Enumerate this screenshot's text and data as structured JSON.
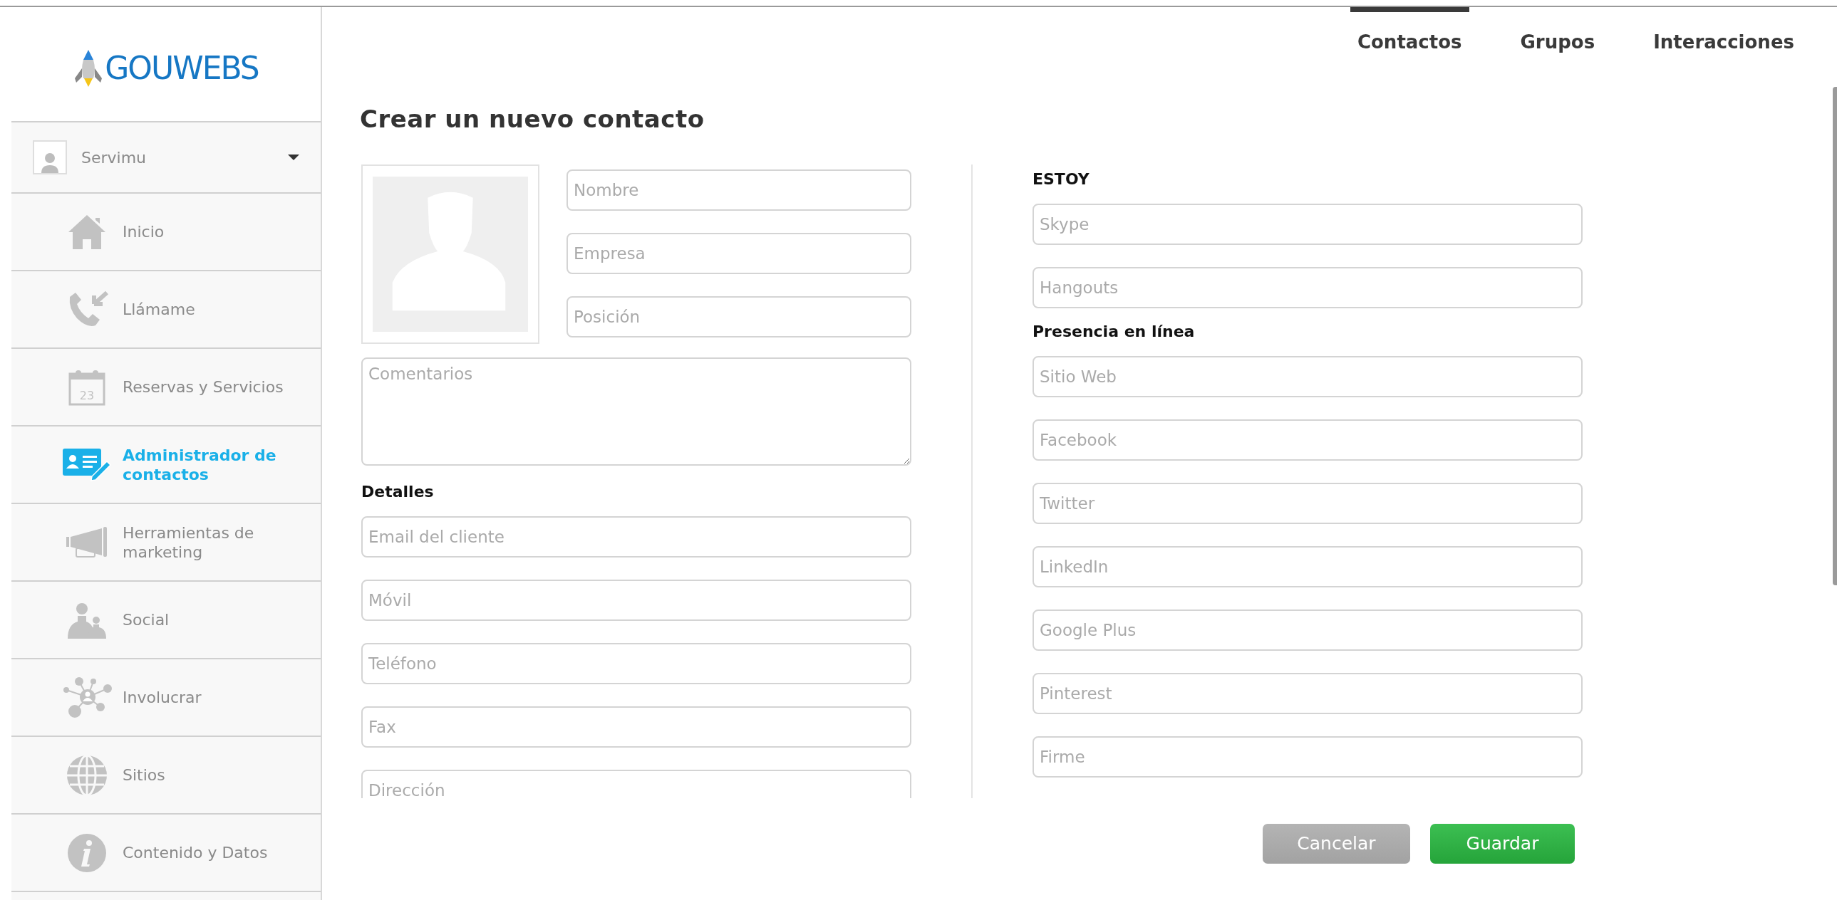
{
  "logo": {
    "text": "GOUWEBS"
  },
  "user": {
    "name": "Servimu"
  },
  "sidebar": {
    "items": [
      {
        "label": "Inicio",
        "selected": false
      },
      {
        "label": "Llámame",
        "selected": false
      },
      {
        "label": "Reservas y Servicios",
        "selected": false,
        "calendar_day": "23"
      },
      {
        "label": "Administrador de contactos",
        "selected": true
      },
      {
        "label": "Herramientas de marketing",
        "selected": false
      },
      {
        "label": "Social",
        "selected": false
      },
      {
        "label": "Involucrar",
        "selected": false
      },
      {
        "label": "Sitios",
        "selected": false
      },
      {
        "label": "Contenido y Datos",
        "selected": false
      }
    ]
  },
  "tabs": [
    {
      "label": "Contactos",
      "selected": true
    },
    {
      "label": "Grupos",
      "selected": false
    },
    {
      "label": "Interacciones",
      "selected": false
    }
  ],
  "title": "Crear un nuevo contacto",
  "identity_fields": [
    {
      "placeholder": "Nombre"
    },
    {
      "placeholder": "Empresa"
    },
    {
      "placeholder": "Posición"
    }
  ],
  "comments": {
    "placeholder": "Comentarios"
  },
  "details": {
    "heading": "Detalles",
    "fields": [
      {
        "placeholder": "Email del cliente"
      },
      {
        "placeholder": "Móvil"
      },
      {
        "placeholder": "Teléfono"
      },
      {
        "placeholder": "Fax"
      },
      {
        "placeholder": "Dirección"
      }
    ]
  },
  "im": {
    "heading": "ESTOY",
    "fields": [
      {
        "placeholder": "Skype"
      },
      {
        "placeholder": "Hangouts"
      }
    ]
  },
  "online": {
    "heading": "Presencia en línea",
    "fields": [
      {
        "placeholder": "Sitio Web"
      },
      {
        "placeholder": "Facebook"
      },
      {
        "placeholder": "Twitter"
      },
      {
        "placeholder": "LinkedIn"
      },
      {
        "placeholder": "Google Plus"
      },
      {
        "placeholder": "Pinterest"
      },
      {
        "placeholder": "Firme"
      }
    ]
  },
  "buttons": {
    "cancel": "Cancelar",
    "save": "Guardar"
  }
}
